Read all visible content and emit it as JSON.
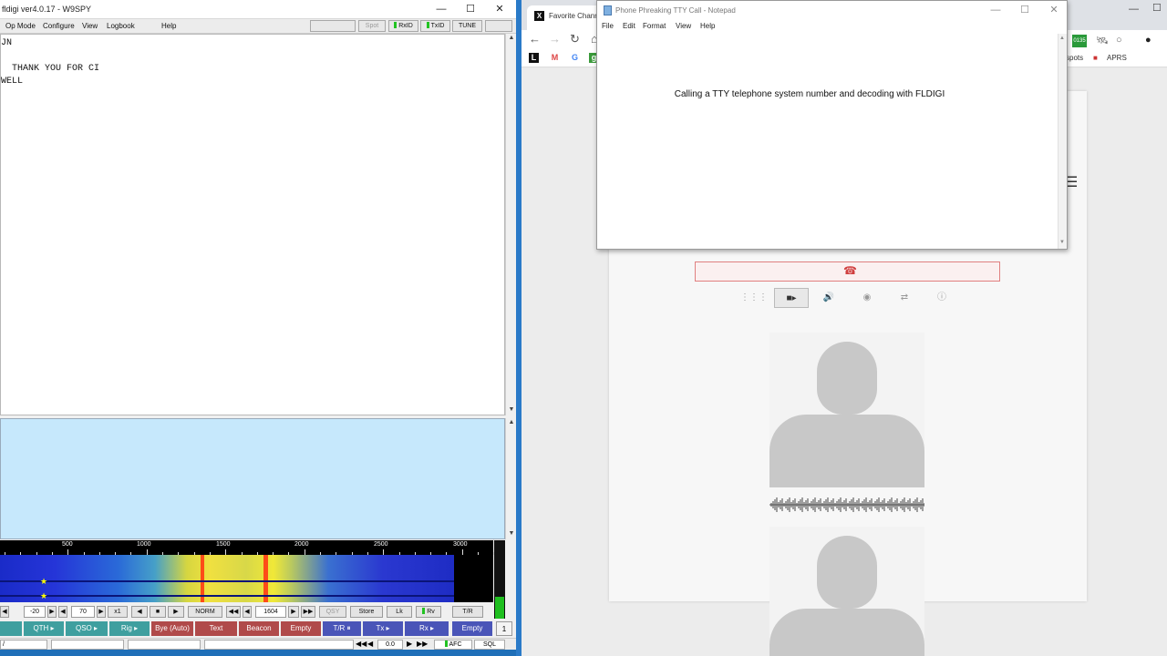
{
  "fldigi": {
    "title": "fldigi ver4.0.17 - W9SPY",
    "menu": [
      "Op Mode",
      "Configure",
      "View",
      "Logbook",
      "Help"
    ],
    "header_buttons": {
      "spot": "Spot",
      "rxid": "RxID",
      "txid": "TxID",
      "tune": "TUNE"
    },
    "rx_lines": [
      "JN",
      "",
      "  THANK YOU FOR CI",
      "WELL"
    ],
    "ruler_labels": [
      "500",
      "1000",
      "1500",
      "2000",
      "2500",
      "3000"
    ],
    "controls": {
      "squelch_value": "-20",
      "level_value": "70",
      "mult": "x1",
      "mode": "NORM",
      "freq": "1604",
      "qsy": "QSY",
      "store": "Store",
      "lk": "Lk",
      "rv": "Rv",
      "tr": "T/R"
    },
    "macros": [
      {
        "label": "",
        "color": "teal"
      },
      {
        "label": "QTH ▸",
        "color": "teal"
      },
      {
        "label": "QSO ▸",
        "color": "teal"
      },
      {
        "label": "Rig ▸",
        "color": "teal"
      },
      {
        "label": "Bye (Auto)",
        "color": "red"
      },
      {
        "label": "Text",
        "color": "red"
      },
      {
        "label": "Beacon",
        "color": "red"
      },
      {
        "label": "Empty",
        "color": "red"
      },
      {
        "label": "T/R ⏸",
        "color": "blue"
      },
      {
        "label": "Tx ▸",
        "color": "blue"
      },
      {
        "label": "Rx ▸",
        "color": "blue"
      },
      {
        "label": "Empty",
        "color": "blue"
      },
      {
        "label": "1",
        "color": "white"
      }
    ],
    "status": {
      "left": "/",
      "offset": "0.0",
      "afc": "AFC",
      "sql": "SQL"
    }
  },
  "browser": {
    "tab_title": "Favorite Chann",
    "bookmarks_right": {
      "spots": "spots",
      "aprs": "APRS"
    },
    "extension_badge": "0135"
  },
  "notepad": {
    "title": "Phone Phreaking TTY Call - Notepad",
    "menu": [
      "File",
      "Edit",
      "Format",
      "View",
      "Help"
    ],
    "text": "Calling a TTY telephone system number and decoding with FLDIGI"
  },
  "icons": {
    "back": "arrow-left",
    "forward": "arrow-right",
    "reload": "reload",
    "home": "home",
    "hangup": "hangup",
    "dialpad": "dialpad",
    "video": "video-camera",
    "speaker": "speaker",
    "record": "record",
    "transfer": "transfer",
    "info": "info"
  }
}
